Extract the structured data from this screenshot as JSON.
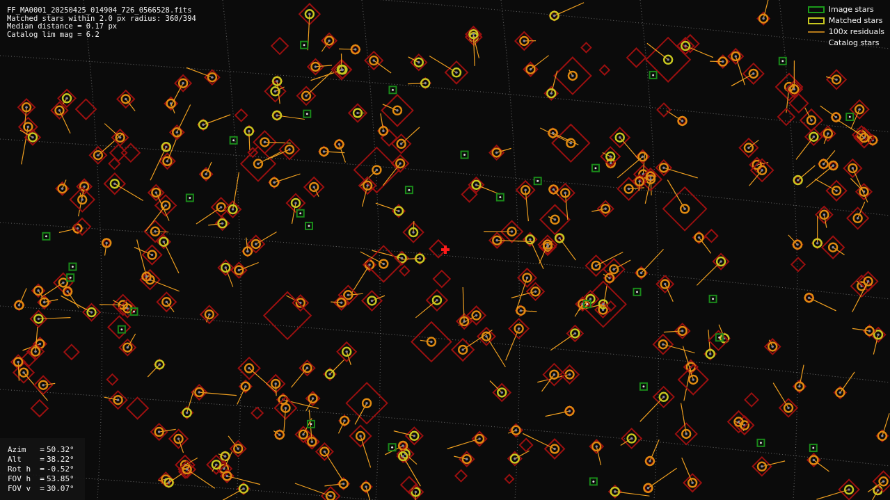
{
  "header_lines": [
    "FF_MA0001_20250425_014904_726_0566528.fits",
    "Matched stars within 2.0 px radius: 360/394",
    "Median distance = 0.17 px",
    "Catalog lim mag = 6.2"
  ],
  "legend": [
    {
      "kind": "image",
      "label": "Image stars"
    },
    {
      "kind": "matched",
      "label": "Matched stars"
    },
    {
      "kind": "residual",
      "label": "100x residuals"
    },
    {
      "kind": "catalog",
      "label": "Catalog stars"
    }
  ],
  "pointing": [
    {
      "label": "Azim   =",
      "value": "50.32°"
    },
    {
      "label": "Alt    =",
      "value": "38.22°"
    },
    {
      "label": "Rot h  =",
      "value": "-0.52°"
    },
    {
      "label": "FOV h  =",
      "value": "53.85°"
    },
    {
      "label": "FOV v  =",
      "value": "30.07°"
    }
  ]
}
